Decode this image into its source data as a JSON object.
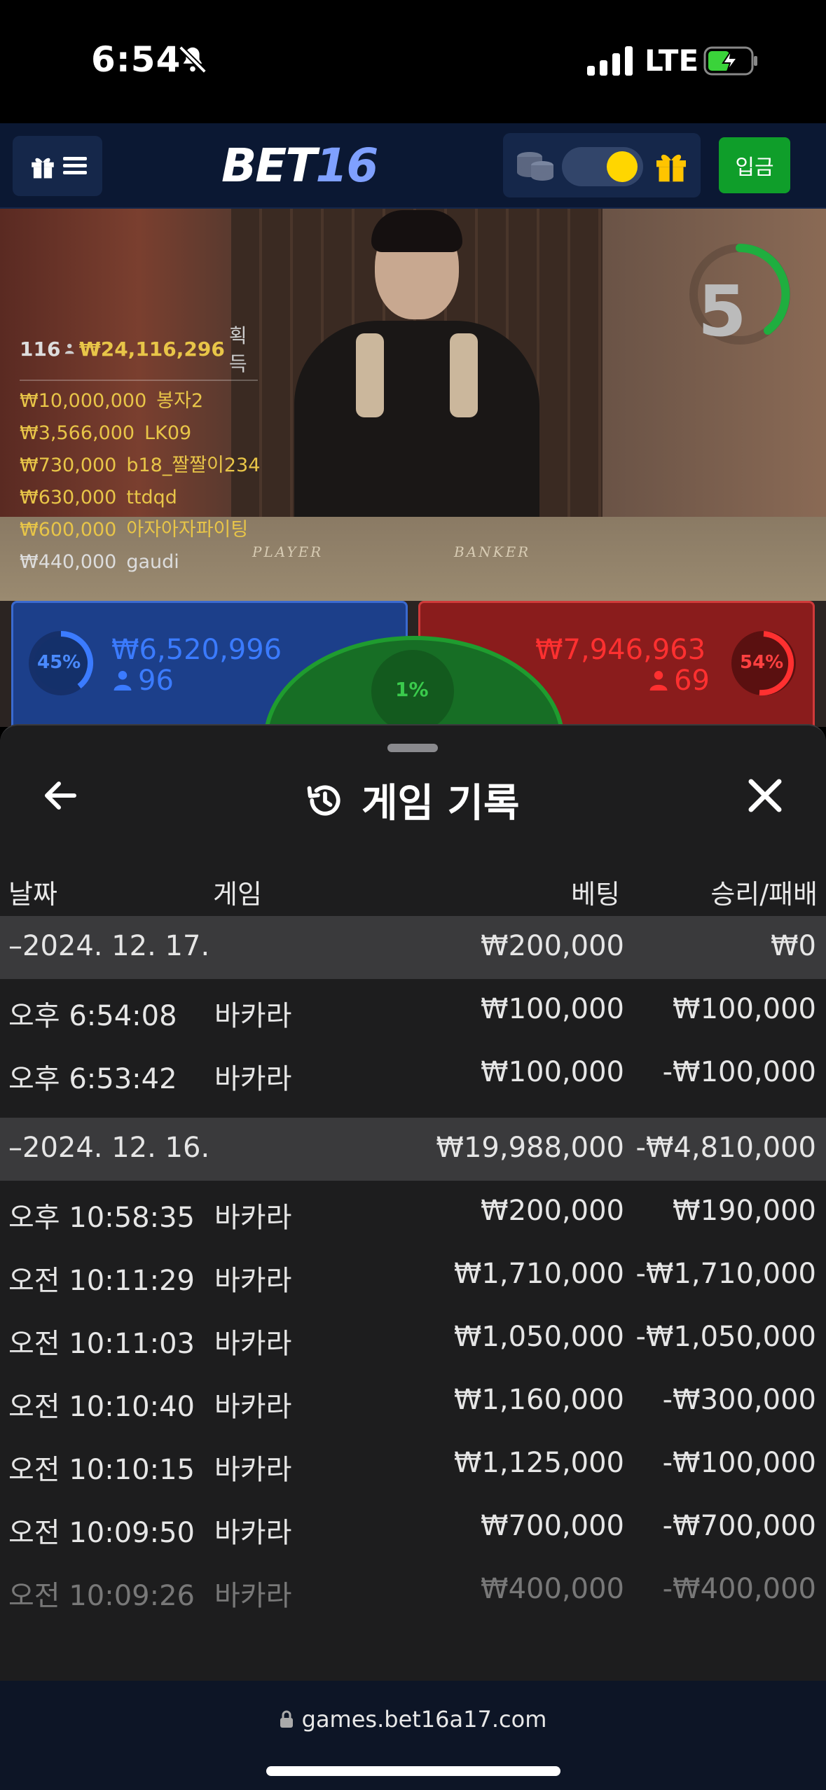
{
  "status_bar": {
    "time": "6:54",
    "network": "LTE"
  },
  "header": {
    "logo_part1": "BET",
    "logo_part2": "16",
    "deposit_label": "입금"
  },
  "video": {
    "countdown": "5",
    "table_player_label": "PLAYER",
    "table_banker_label": "BANKER",
    "winners_summary": {
      "count": "116",
      "total": "₩24,116,296",
      "label": "획득"
    },
    "winners": [
      {
        "amount": "₩10,000,000",
        "name": "봉자2"
      },
      {
        "amount": "₩3,566,000",
        "name": "LK09"
      },
      {
        "amount": "₩730,000",
        "name": "b18_짤짤이234"
      },
      {
        "amount": "₩630,000",
        "name": "ttdqd"
      },
      {
        "amount": "₩600,000",
        "name": "아자아자파이팅"
      },
      {
        "amount": "₩440,000",
        "name": "gaudi"
      }
    ]
  },
  "betting": {
    "player": {
      "percent": "45%",
      "percent_value": 45,
      "amount": "₩6,520,996",
      "players": "96",
      "color": "#1c3f8a"
    },
    "tie": {
      "percent": "1%",
      "percent_value": 1,
      "color": "#176e25"
    },
    "banker": {
      "percent": "54%",
      "percent_value": 54,
      "amount": "₩7,946,963",
      "players": "69",
      "color": "#8a1c1c"
    }
  },
  "history": {
    "title": "게임 기록",
    "columns": {
      "date": "날짜",
      "game": "게임",
      "bet": "베팅",
      "result": "승리/패배"
    },
    "groups": [
      {
        "date": "–2024. 12. 17.",
        "bet_total": "₩200,000",
        "result_total": "₩0",
        "rows": [
          {
            "time": "오후 6:54:08",
            "game": "바카라",
            "bet": "₩100,000",
            "result": "₩100,000"
          },
          {
            "time": "오후 6:53:42",
            "game": "바카라",
            "bet": "₩100,000",
            "result": "-₩100,000"
          }
        ]
      },
      {
        "date": "–2024. 12. 16.",
        "bet_total": "₩19,988,000",
        "result_total": "-₩4,810,000",
        "rows": [
          {
            "time": "오후 10:58:35",
            "game": "바카라",
            "bet": "₩200,000",
            "result": "₩190,000"
          },
          {
            "time": "오전 10:11:29",
            "game": "바카라",
            "bet": "₩1,710,000",
            "result": "-₩1,710,000"
          },
          {
            "time": "오전 10:11:03",
            "game": "바카라",
            "bet": "₩1,050,000",
            "result": "-₩1,050,000"
          },
          {
            "time": "오전 10:10:40",
            "game": "바카라",
            "bet": "₩1,160,000",
            "result": "-₩300,000"
          },
          {
            "time": "오전 10:10:15",
            "game": "바카라",
            "bet": "₩1,125,000",
            "result": "-₩100,000"
          },
          {
            "time": "오전 10:09:50",
            "game": "바카라",
            "bet": "₩700,000",
            "result": "-₩700,000"
          },
          {
            "time": "오전 10:09:26",
            "game": "바카라",
            "bet": "₩400,000",
            "result": "-₩400,000"
          }
        ]
      }
    ]
  },
  "browser": {
    "url": "games.bet16a17.com"
  }
}
